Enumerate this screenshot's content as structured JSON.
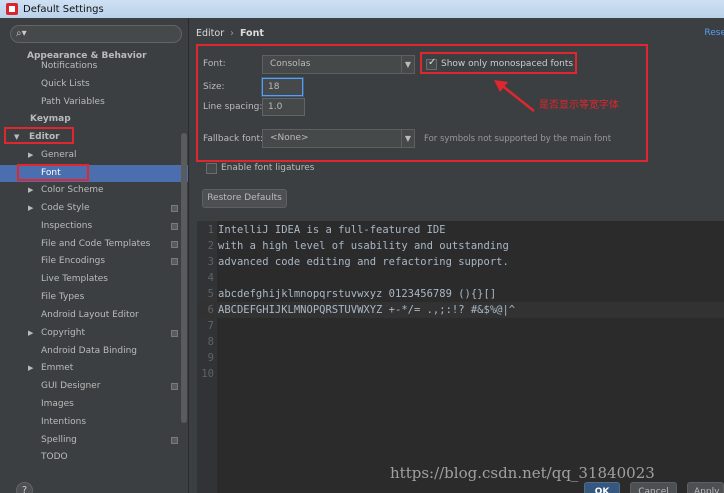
{
  "window": {
    "title": "Default Settings"
  },
  "search": {
    "placeholder": ""
  },
  "sidebar": {
    "items": [
      {
        "label": "Appearance & Behavior",
        "bold": true
      },
      {
        "label": "Notifications"
      },
      {
        "label": "Quick Lists"
      },
      {
        "label": "Path Variables"
      },
      {
        "label": "Keymap",
        "bold": true
      },
      {
        "label": "Editor",
        "bold": true
      },
      {
        "label": "General"
      },
      {
        "label": "Font",
        "selected": true
      },
      {
        "label": "Color Scheme"
      },
      {
        "label": "Code Style"
      },
      {
        "label": "Inspections"
      },
      {
        "label": "File and Code Templates"
      },
      {
        "label": "File Encodings"
      },
      {
        "label": "Live Templates"
      },
      {
        "label": "File Types"
      },
      {
        "label": "Android Layout Editor"
      },
      {
        "label": "Copyright"
      },
      {
        "label": "Android Data Binding"
      },
      {
        "label": "Emmet"
      },
      {
        "label": "GUI Designer"
      },
      {
        "label": "Images"
      },
      {
        "label": "Intentions"
      },
      {
        "label": "Spelling"
      },
      {
        "label": "TODO"
      }
    ]
  },
  "breadcrumb": {
    "part1": "Editor",
    "part2": "Font"
  },
  "reset_link": "Rese",
  "font": {
    "font_label": "Font:",
    "font_value": "Consolas",
    "mono_checkbox_label": "Show only monospaced fonts",
    "mono_checked": true,
    "size_label": "Size:",
    "size_value": "18",
    "spacing_label": "Line spacing:",
    "spacing_value": "1.0",
    "fallback_label": "Fallback font:",
    "fallback_value": "<None>",
    "fallback_hint": "For symbols not supported by the main font",
    "ligatures_label": "Enable font ligatures",
    "ligatures_checked": false,
    "restore_button": "Restore Defaults"
  },
  "annotation": {
    "text": "是否显示等宽字体",
    "color": "#e0262f"
  },
  "preview": {
    "lines": [
      {
        "num": "1",
        "text": "IntelliJ IDEA is a full-featured IDE"
      },
      {
        "num": "2",
        "text": "with a high level of usability and outstanding"
      },
      {
        "num": "3",
        "text": "advanced code editing and refactoring support."
      },
      {
        "num": "4",
        "text": ""
      },
      {
        "num": "5",
        "text": "abcdefghijklmnopqrstuvwxyz 0123456789 (){}[]"
      },
      {
        "num": "6",
        "text": "ABCDEFGHIJKLMNOPQRSTUVWXYZ +-*/= .,;:!? #&$%@|^"
      },
      {
        "num": "7",
        "text": ""
      },
      {
        "num": "8",
        "text": ""
      },
      {
        "num": "9",
        "text": ""
      },
      {
        "num": "10",
        "text": ""
      }
    ]
  },
  "watermark": "https://blog.csdn.net/qq_31840023",
  "buttons": {
    "ok": "OK",
    "cancel": "Cancel",
    "apply": "Apply"
  },
  "colors": {
    "accent": "#4b6eaf",
    "link": "#589df6",
    "annotation": "#e0262f",
    "background": "#3c3f41",
    "editor_bg": "#2b2b2b"
  }
}
